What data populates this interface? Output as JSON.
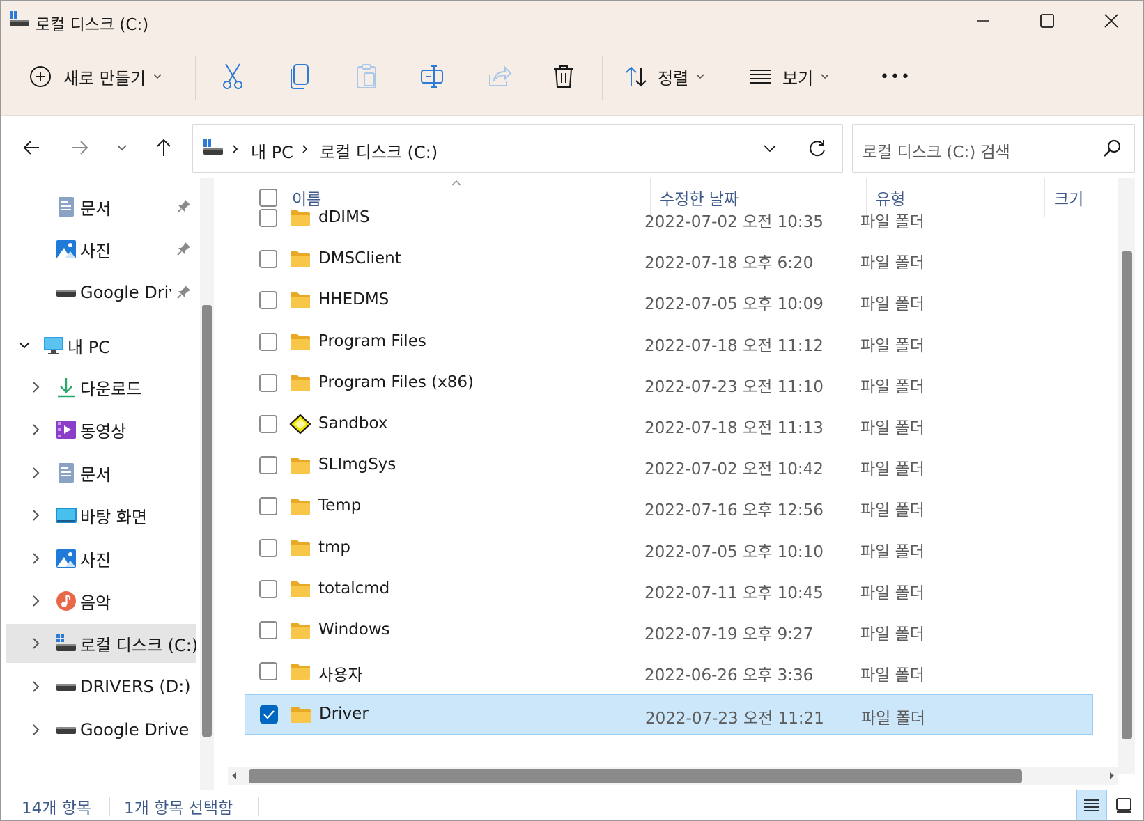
{
  "window": {
    "title": "로컬 디스크 (C:)"
  },
  "toolbar": {
    "new_label": "새로 만들기",
    "sort_label": "정렬",
    "view_label": "보기",
    "more_label": "•••"
  },
  "address": {
    "segments": [
      "내 PC",
      "로컬 디스크 (C:)"
    ],
    "search_placeholder": "로컬 디스크 (C:) 검색"
  },
  "sidebar": {
    "quick": [
      {
        "label": "문서",
        "icon": "documents-icon"
      },
      {
        "label": "사진",
        "icon": "pictures-icon"
      },
      {
        "label": "Google Drive",
        "icon": "drive-icon"
      }
    ],
    "this_pc_label": "내 PC",
    "pc_items": [
      {
        "label": "다운로드",
        "icon": "downloads-icon"
      },
      {
        "label": "동영상",
        "icon": "videos-icon"
      },
      {
        "label": "문서",
        "icon": "documents-icon"
      },
      {
        "label": "바탕 화면",
        "icon": "desktop-icon"
      },
      {
        "label": "사진",
        "icon": "pictures-icon"
      },
      {
        "label": "음악",
        "icon": "music-icon"
      },
      {
        "label": "로컬 디스크 (C:)",
        "icon": "local-disk-icon",
        "selected": true
      },
      {
        "label": "DRIVERS (D:)",
        "icon": "drive-icon"
      },
      {
        "label": "Google Drive (G:)",
        "icon": "drive-icon"
      }
    ]
  },
  "columns": {
    "name": "이름",
    "date": "수정한 날짜",
    "type": "유형",
    "size": "크기"
  },
  "files": [
    {
      "name": "dDIMS",
      "date": "2022-07-02 오전 10:35",
      "type": "파일 폴더",
      "icon": "folder-icon"
    },
    {
      "name": "DMSClient",
      "date": "2022-07-18 오후 6:20",
      "type": "파일 폴더",
      "icon": "folder-icon"
    },
    {
      "name": "HHEDMS",
      "date": "2022-07-05 오후 10:09",
      "type": "파일 폴더",
      "icon": "folder-icon"
    },
    {
      "name": "Program Files",
      "date": "2022-07-18 오전 11:12",
      "type": "파일 폴더",
      "icon": "folder-icon"
    },
    {
      "name": "Program Files (x86)",
      "date": "2022-07-23 오전 11:10",
      "type": "파일 폴더",
      "icon": "folder-icon"
    },
    {
      "name": "Sandbox",
      "date": "2022-07-18 오전 11:13",
      "type": "파일 폴더",
      "icon": "sandbox-icon"
    },
    {
      "name": "SLImgSys",
      "date": "2022-07-02 오전 10:42",
      "type": "파일 폴더",
      "icon": "folder-icon"
    },
    {
      "name": "Temp",
      "date": "2022-07-16 오후 12:56",
      "type": "파일 폴더",
      "icon": "folder-icon"
    },
    {
      "name": "tmp",
      "date": "2022-07-05 오후 10:10",
      "type": "파일 폴더",
      "icon": "folder-icon"
    },
    {
      "name": "totalcmd",
      "date": "2022-07-11 오후 10:45",
      "type": "파일 폴더",
      "icon": "folder-icon"
    },
    {
      "name": "Windows",
      "date": "2022-07-19 오후 9:27",
      "type": "파일 폴더",
      "icon": "folder-icon"
    },
    {
      "name": "사용자",
      "date": "2022-06-26 오후 3:36",
      "type": "파일 폴더",
      "icon": "folder-icon"
    },
    {
      "name": "Driver",
      "date": "2022-07-23 오전 11:21",
      "type": "파일 폴더",
      "icon": "folder-icon",
      "selected": true
    }
  ],
  "status": {
    "count": "14개 항목",
    "selected": "1개 항목 선택함"
  },
  "colors": {
    "titlebar_bg": "#f6ede6",
    "accent": "#0067c0",
    "selection_bg": "#cce6fa",
    "folder_yellow": "#f8c649"
  }
}
